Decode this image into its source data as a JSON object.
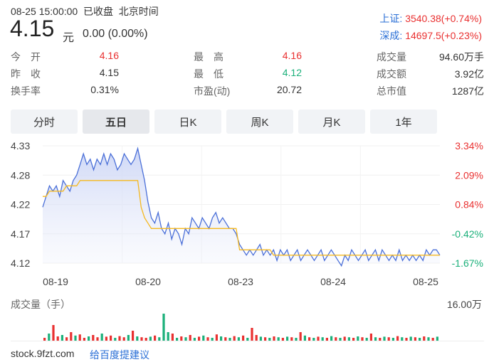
{
  "header": {
    "datetime": "08-25 15:00:00",
    "status": "已收盘",
    "tz": "北京时间",
    "price": "4.15",
    "price_unit": "元",
    "change": "0.00 (0.00%)"
  },
  "indices": [
    {
      "name": "上证:",
      "value": "3540.38(+0.74%)"
    },
    {
      "name": "深成:",
      "value": "14697.5(+0.23%)"
    }
  ],
  "stats": [
    [
      {
        "label": "今　开",
        "value": "4.16",
        "tone": "red"
      },
      {
        "label": "最　高",
        "value": "4.16",
        "tone": "red"
      },
      {
        "label": "成交量",
        "value": "94.60万手",
        "tone": ""
      }
    ],
    [
      {
        "label": "昨　收",
        "value": "4.15",
        "tone": ""
      },
      {
        "label": "最　低",
        "value": "4.12",
        "tone": "green"
      },
      {
        "label": "成交额",
        "value": "3.92亿",
        "tone": ""
      }
    ],
    [
      {
        "label": "换手率",
        "value": "0.31%",
        "tone": ""
      },
      {
        "label": "市盈(动)",
        "value": "20.72",
        "tone": ""
      },
      {
        "label": "总市值",
        "value": "1287亿",
        "tone": ""
      }
    ]
  ],
  "tabs": [
    {
      "label": "分时",
      "active": false
    },
    {
      "label": "五日",
      "active": true
    },
    {
      "label": "日K",
      "active": false
    },
    {
      "label": "周K",
      "active": false
    },
    {
      "label": "月K",
      "active": false
    },
    {
      "label": "1年",
      "active": false
    }
  ],
  "chart_data": {
    "type": "line",
    "series": [
      {
        "role": "price",
        "color": "#4a6fd8",
        "values": [
          4.22,
          4.24,
          4.26,
          4.25,
          4.26,
          4.24,
          4.27,
          4.26,
          4.25,
          4.27,
          4.28,
          4.3,
          4.32,
          4.3,
          4.31,
          4.29,
          4.31,
          4.3,
          4.32,
          4.3,
          4.32,
          4.31,
          4.29,
          4.3,
          4.32,
          4.31,
          4.3,
          4.31,
          4.33,
          4.3,
          4.27,
          4.23,
          4.2,
          4.19,
          4.21,
          4.18,
          4.17,
          4.19,
          4.16,
          4.18,
          4.17,
          4.15,
          4.18,
          4.17,
          4.2,
          4.19,
          4.18,
          4.2,
          4.19,
          4.18,
          4.2,
          4.21,
          4.19,
          4.2,
          4.19,
          4.18,
          4.18,
          4.17,
          4.15,
          4.14,
          4.13,
          4.14,
          4.13,
          4.14,
          4.15,
          4.13,
          4.14,
          4.13,
          4.14,
          4.12,
          4.14,
          4.13,
          4.14,
          4.12,
          4.13,
          4.14,
          4.12,
          4.13,
          4.14,
          4.13,
          4.12,
          4.13,
          4.14,
          4.12,
          4.13,
          4.14,
          4.13,
          4.12,
          4.11,
          4.13,
          4.12,
          4.14,
          4.13,
          4.12,
          4.13,
          4.14,
          4.12,
          4.13,
          4.14,
          4.12,
          4.14,
          4.13,
          4.12,
          4.13,
          4.12,
          4.14,
          4.12,
          4.13,
          4.12,
          4.13,
          4.12,
          4.13,
          4.12,
          4.14,
          4.13,
          4.14,
          4.14,
          4.13
        ]
      },
      {
        "role": "average",
        "color": "#f5b81e",
        "values": [
          4.24,
          4.24,
          4.25,
          4.25,
          4.25,
          4.25,
          4.25,
          4.26,
          4.26,
          4.26,
          4.26,
          4.27,
          4.27,
          4.27,
          4.27,
          4.27,
          4.27,
          4.27,
          4.27,
          4.27,
          4.27,
          4.27,
          4.27,
          4.27,
          4.27,
          4.27,
          4.27,
          4.27,
          4.27,
          4.22,
          4.2,
          4.19,
          4.18,
          4.18,
          4.18,
          4.18,
          4.18,
          4.18,
          4.18,
          4.18,
          4.18,
          4.18,
          4.18,
          4.18,
          4.18,
          4.18,
          4.18,
          4.18,
          4.18,
          4.18,
          4.18,
          4.18,
          4.18,
          4.18,
          4.18,
          4.18,
          4.18,
          4.18,
          4.14,
          4.14,
          4.14,
          4.14,
          4.14,
          4.14,
          4.14,
          4.14,
          4.14,
          4.14,
          4.13,
          4.13,
          4.13,
          4.13,
          4.13,
          4.13,
          4.13,
          4.13,
          4.13,
          4.13,
          4.13,
          4.13,
          4.13,
          4.13,
          4.13,
          4.13,
          4.13,
          4.13,
          4.13,
          4.13,
          4.13,
          4.13,
          4.13,
          4.13,
          4.13,
          4.13,
          4.13,
          4.13,
          4.13,
          4.13,
          4.13,
          4.13,
          4.13,
          4.13,
          4.13,
          4.13,
          4.13,
          4.13,
          4.13,
          4.13,
          4.13,
          4.13,
          4.13,
          4.13,
          4.13,
          4.13,
          4.13,
          4.13,
          4.13,
          4.13
        ]
      }
    ],
    "y_ticks": [
      "4.33",
      "4.28",
      "4.22",
      "4.17",
      "4.12"
    ],
    "pct_ticks": [
      "3.34%",
      "2.09%",
      "0.84%",
      "-0.42%",
      "-1.67%"
    ],
    "pct_tones": [
      "red",
      "red",
      "red",
      "green",
      "green"
    ],
    "x_ticks": [
      "08-19",
      "08-20",
      "08-23",
      "08-24",
      "08-25"
    ],
    "ylim": [
      4.1,
      4.35
    ],
    "prev_close": 4.15,
    "days": 5
  },
  "volume": {
    "title": "成交量（手）",
    "max": "16.00万",
    "bars": [
      {
        "v": 0.1,
        "c": "red"
      },
      {
        "v": 0.25,
        "c": "green"
      },
      {
        "v": 0.55,
        "c": "red"
      },
      {
        "v": 0.15,
        "c": "red"
      },
      {
        "v": 0.2,
        "c": "green"
      },
      {
        "v": 0.12,
        "c": "red"
      },
      {
        "v": 0.3,
        "c": "red"
      },
      {
        "v": 0.18,
        "c": "green"
      },
      {
        "v": 0.22,
        "c": "red"
      },
      {
        "v": 0.1,
        "c": "red"
      },
      {
        "v": 0.15,
        "c": "green"
      },
      {
        "v": 0.2,
        "c": "red"
      },
      {
        "v": 0.12,
        "c": "red"
      },
      {
        "v": 0.25,
        "c": "green"
      },
      {
        "v": 0.14,
        "c": "red"
      },
      {
        "v": 0.18,
        "c": "red"
      },
      {
        "v": 0.1,
        "c": "green"
      },
      {
        "v": 0.16,
        "c": "red"
      },
      {
        "v": 0.12,
        "c": "red"
      },
      {
        "v": 0.2,
        "c": "green"
      },
      {
        "v": 0.35,
        "c": "red"
      },
      {
        "v": 0.15,
        "c": "green"
      },
      {
        "v": 0.12,
        "c": "red"
      },
      {
        "v": 0.1,
        "c": "red"
      },
      {
        "v": 0.14,
        "c": "green"
      },
      {
        "v": 0.18,
        "c": "red"
      },
      {
        "v": 0.12,
        "c": "green"
      },
      {
        "v": 0.95,
        "c": "green"
      },
      {
        "v": 0.3,
        "c": "green"
      },
      {
        "v": 0.25,
        "c": "red"
      },
      {
        "v": 0.1,
        "c": "green"
      },
      {
        "v": 0.15,
        "c": "red"
      },
      {
        "v": 0.12,
        "c": "green"
      },
      {
        "v": 0.2,
        "c": "red"
      },
      {
        "v": 0.1,
        "c": "green"
      },
      {
        "v": 0.14,
        "c": "red"
      },
      {
        "v": 0.18,
        "c": "green"
      },
      {
        "v": 0.12,
        "c": "red"
      },
      {
        "v": 0.1,
        "c": "green"
      },
      {
        "v": 0.22,
        "c": "red"
      },
      {
        "v": 0.15,
        "c": "green"
      },
      {
        "v": 0.12,
        "c": "red"
      },
      {
        "v": 0.1,
        "c": "green"
      },
      {
        "v": 0.16,
        "c": "red"
      },
      {
        "v": 0.12,
        "c": "green"
      },
      {
        "v": 0.18,
        "c": "red"
      },
      {
        "v": 0.1,
        "c": "green"
      },
      {
        "v": 0.45,
        "c": "red"
      },
      {
        "v": 0.2,
        "c": "red"
      },
      {
        "v": 0.14,
        "c": "green"
      },
      {
        "v": 0.12,
        "c": "red"
      },
      {
        "v": 0.1,
        "c": "green"
      },
      {
        "v": 0.15,
        "c": "red"
      },
      {
        "v": 0.12,
        "c": "green"
      },
      {
        "v": 0.1,
        "c": "red"
      },
      {
        "v": 0.14,
        "c": "green"
      },
      {
        "v": 0.12,
        "c": "red"
      },
      {
        "v": 0.1,
        "c": "green"
      },
      {
        "v": 0.3,
        "c": "red"
      },
      {
        "v": 0.18,
        "c": "green"
      },
      {
        "v": 0.12,
        "c": "red"
      },
      {
        "v": 0.1,
        "c": "green"
      },
      {
        "v": 0.14,
        "c": "red"
      },
      {
        "v": 0.12,
        "c": "green"
      },
      {
        "v": 0.1,
        "c": "red"
      },
      {
        "v": 0.16,
        "c": "green"
      },
      {
        "v": 0.12,
        "c": "red"
      },
      {
        "v": 0.1,
        "c": "green"
      },
      {
        "v": 0.14,
        "c": "red"
      },
      {
        "v": 0.12,
        "c": "green"
      },
      {
        "v": 0.1,
        "c": "red"
      },
      {
        "v": 0.15,
        "c": "green"
      },
      {
        "v": 0.12,
        "c": "red"
      },
      {
        "v": 0.1,
        "c": "green"
      },
      {
        "v": 0.25,
        "c": "red"
      },
      {
        "v": 0.12,
        "c": "green"
      },
      {
        "v": 0.1,
        "c": "red"
      },
      {
        "v": 0.14,
        "c": "green"
      },
      {
        "v": 0.12,
        "c": "red"
      },
      {
        "v": 0.1,
        "c": "green"
      },
      {
        "v": 0.16,
        "c": "red"
      },
      {
        "v": 0.12,
        "c": "green"
      },
      {
        "v": 0.1,
        "c": "red"
      },
      {
        "v": 0.14,
        "c": "green"
      },
      {
        "v": 0.12,
        "c": "red"
      },
      {
        "v": 0.1,
        "c": "green"
      },
      {
        "v": 0.15,
        "c": "red"
      },
      {
        "v": 0.12,
        "c": "green"
      },
      {
        "v": 0.1,
        "c": "red"
      },
      {
        "v": 0.14,
        "c": "green"
      }
    ]
  },
  "footer": {
    "source": "stock.9fzt.com",
    "feedback": "给百度提建议"
  }
}
